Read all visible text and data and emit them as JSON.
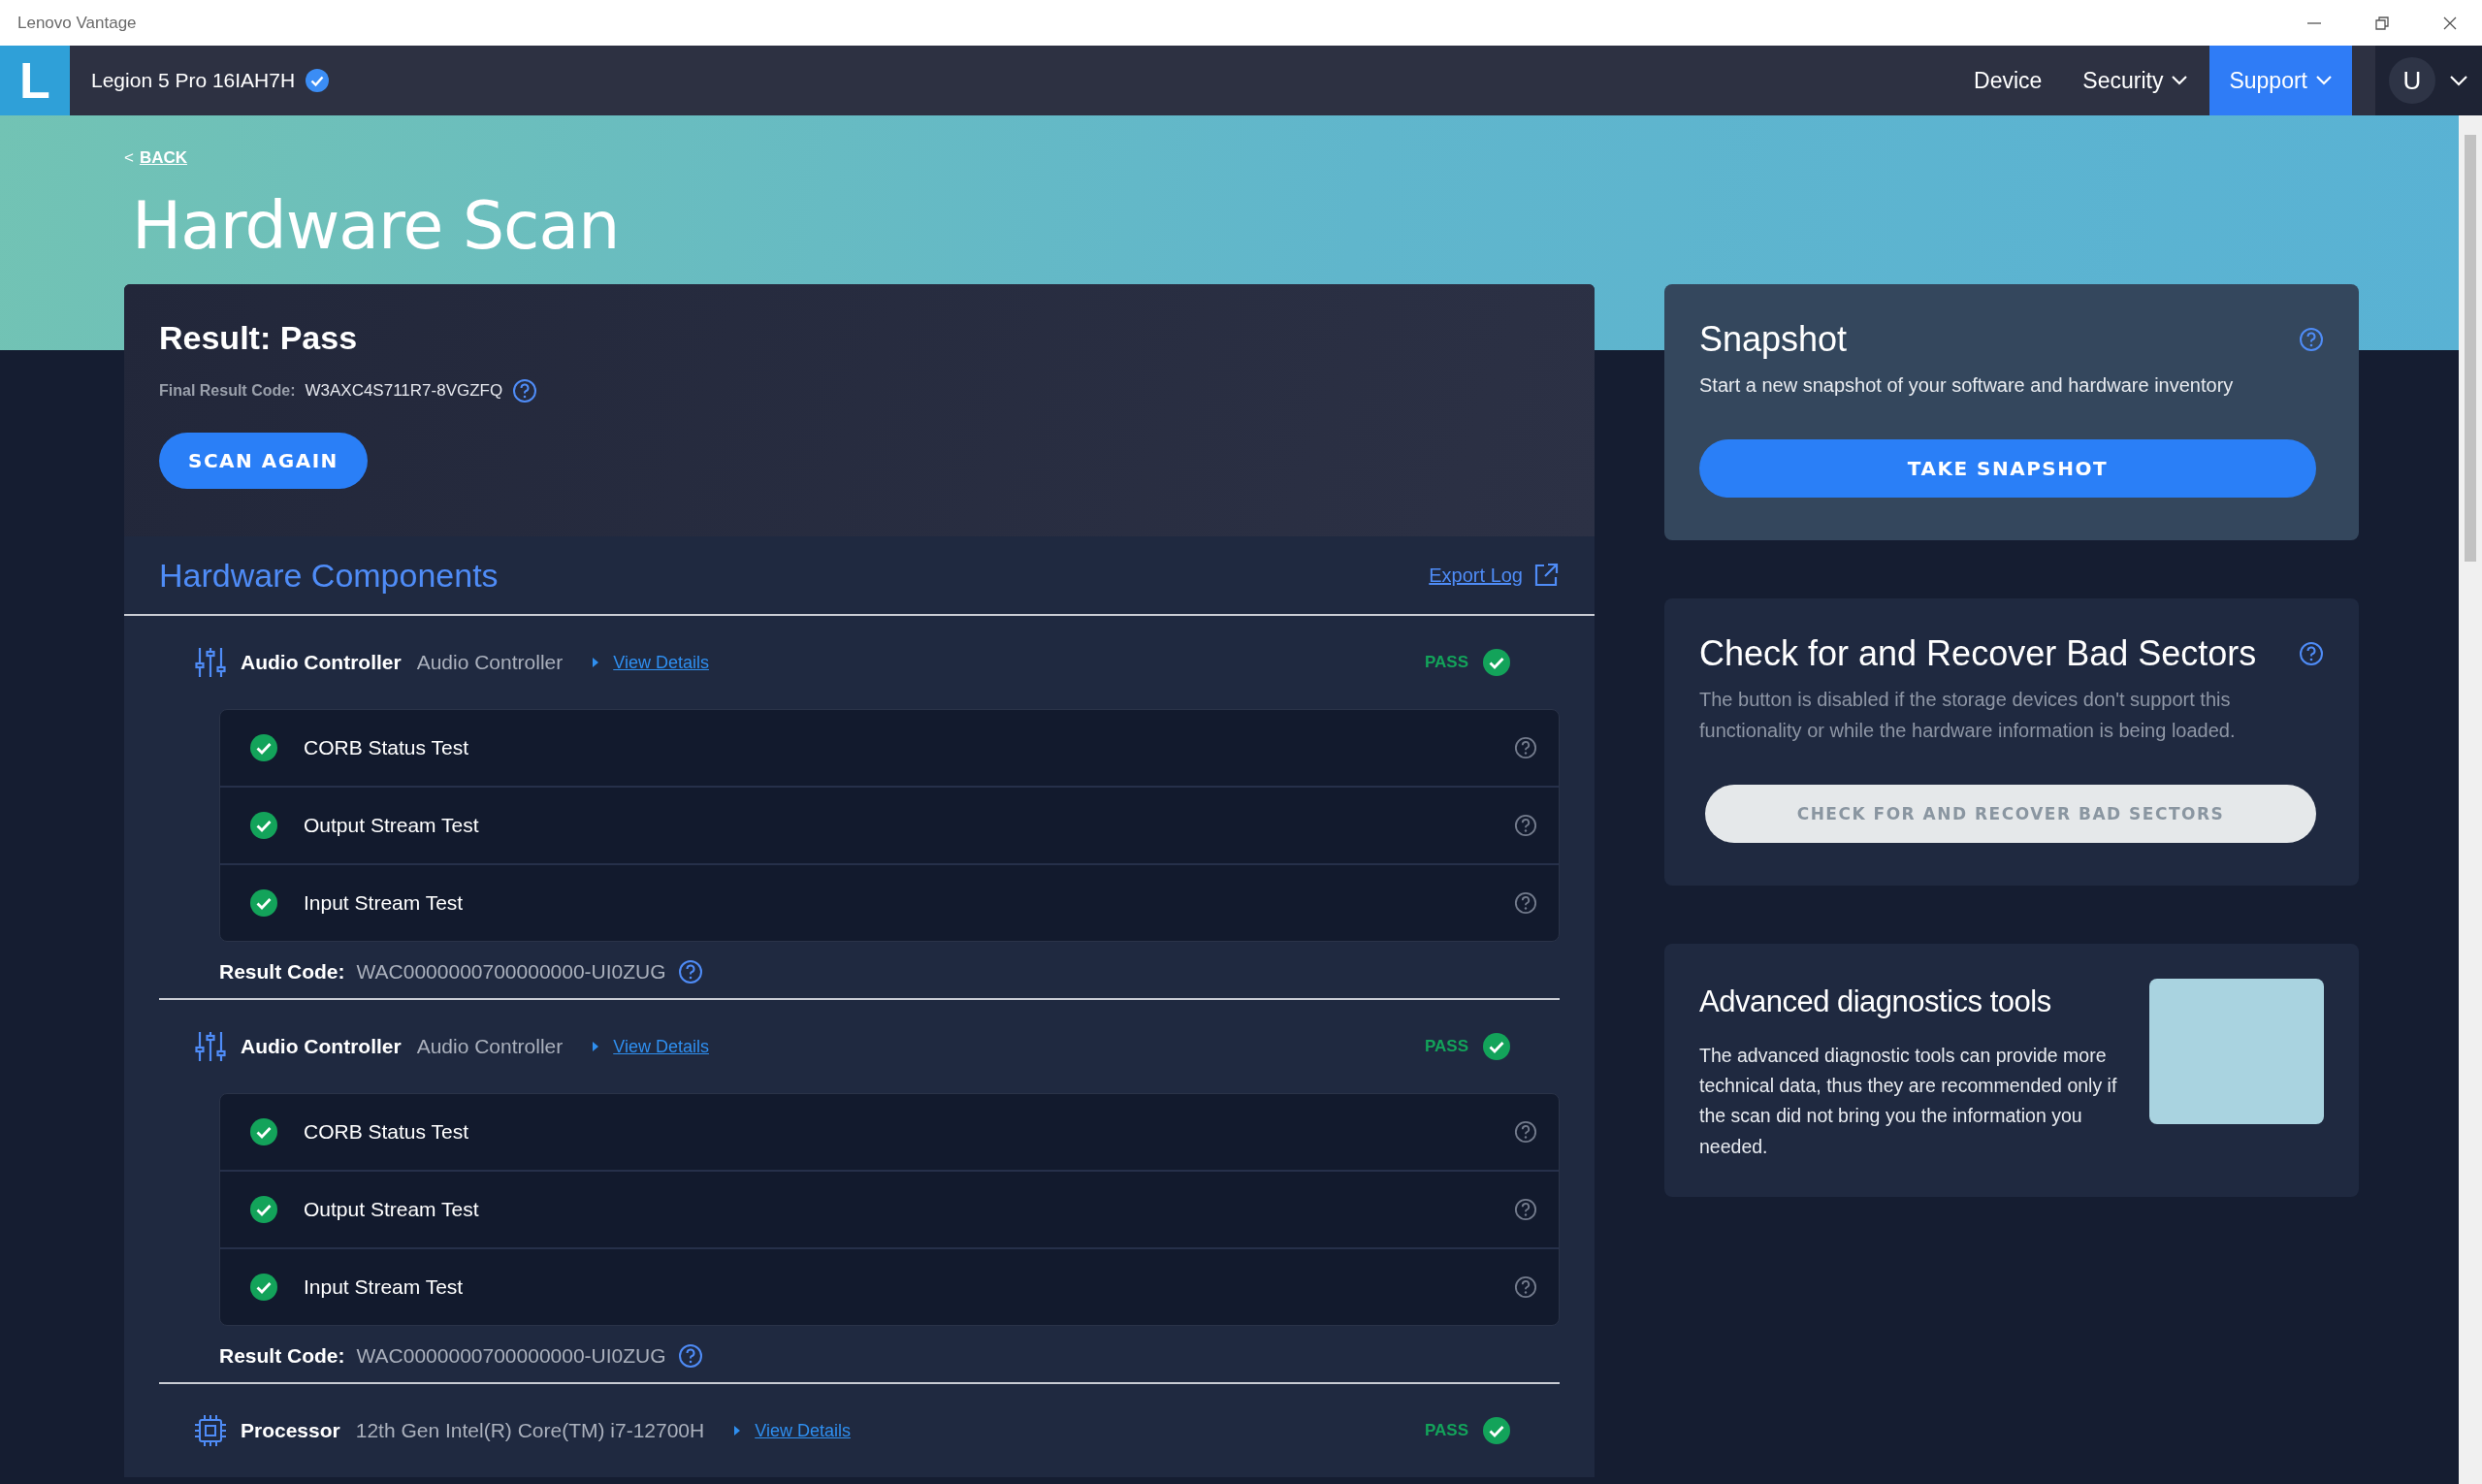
{
  "window": {
    "title": "Lenovo Vantage"
  },
  "nav": {
    "logo": "L",
    "device_name": "Legion 5 Pro 16IAH7H",
    "verified": true,
    "user_initial": "U",
    "items": [
      {
        "label": "Device",
        "selected": false,
        "has_menu": false
      },
      {
        "label": "Security",
        "selected": false,
        "has_menu": true
      },
      {
        "label": "Support",
        "selected": true,
        "has_menu": true
      }
    ]
  },
  "back": {
    "marker": "<",
    "label": "BACK"
  },
  "page_title": "Hardware Scan",
  "result": {
    "title": "Result: Pass",
    "code_label": "Final Result Code:",
    "code": "W3AXC4S711R7-8VGZFQ",
    "button": "SCAN AGAIN"
  },
  "components": {
    "title": "Hardware Components",
    "export": "Export Log",
    "items": [
      {
        "kind": "audio",
        "name": "Audio Controller",
        "description": "Audio Controller",
        "details": "View Details",
        "status": "PASS",
        "tests": [
          {
            "name": "CORB Status Test",
            "passed": true
          },
          {
            "name": "Output Stream Test",
            "passed": true
          },
          {
            "name": "Input Stream Test",
            "passed": true
          }
        ],
        "result_label": "Result Code:",
        "result_code": "WAC0000000700000000-UI0ZUG"
      },
      {
        "kind": "audio",
        "name": "Audio Controller",
        "description": "Audio Controller",
        "details": "View Details",
        "status": "PASS",
        "tests": [
          {
            "name": "CORB Status Test",
            "passed": true
          },
          {
            "name": "Output Stream Test",
            "passed": true
          },
          {
            "name": "Input Stream Test",
            "passed": true
          }
        ],
        "result_label": "Result Code:",
        "result_code": "WAC0000000700000000-UI0ZUG"
      },
      {
        "kind": "processor",
        "name": "Processor",
        "description": "12th Gen Intel(R) Core(TM) i7-12700H",
        "details": "View Details",
        "status": "PASS"
      }
    ]
  },
  "snapshot": {
    "title": "Snapshot",
    "text": "Start a new snapshot of your software and hardware inventory",
    "button": "TAKE SNAPSHOT",
    "disabled": false
  },
  "bad_sectors": {
    "title": "Check for and Recover Bad Sectors",
    "text": "The button is disabled if the storage devices don't support this functionality or while the hardware information is being loaded.",
    "button": "CHECK FOR AND RECOVER BAD SECTORS",
    "disabled": true
  },
  "advanced": {
    "title": "Advanced diagnostics tools",
    "text": "The advanced diagnostic tools can provide more technical data, thus they are recommended only if the scan did not bring you the information you needed."
  }
}
